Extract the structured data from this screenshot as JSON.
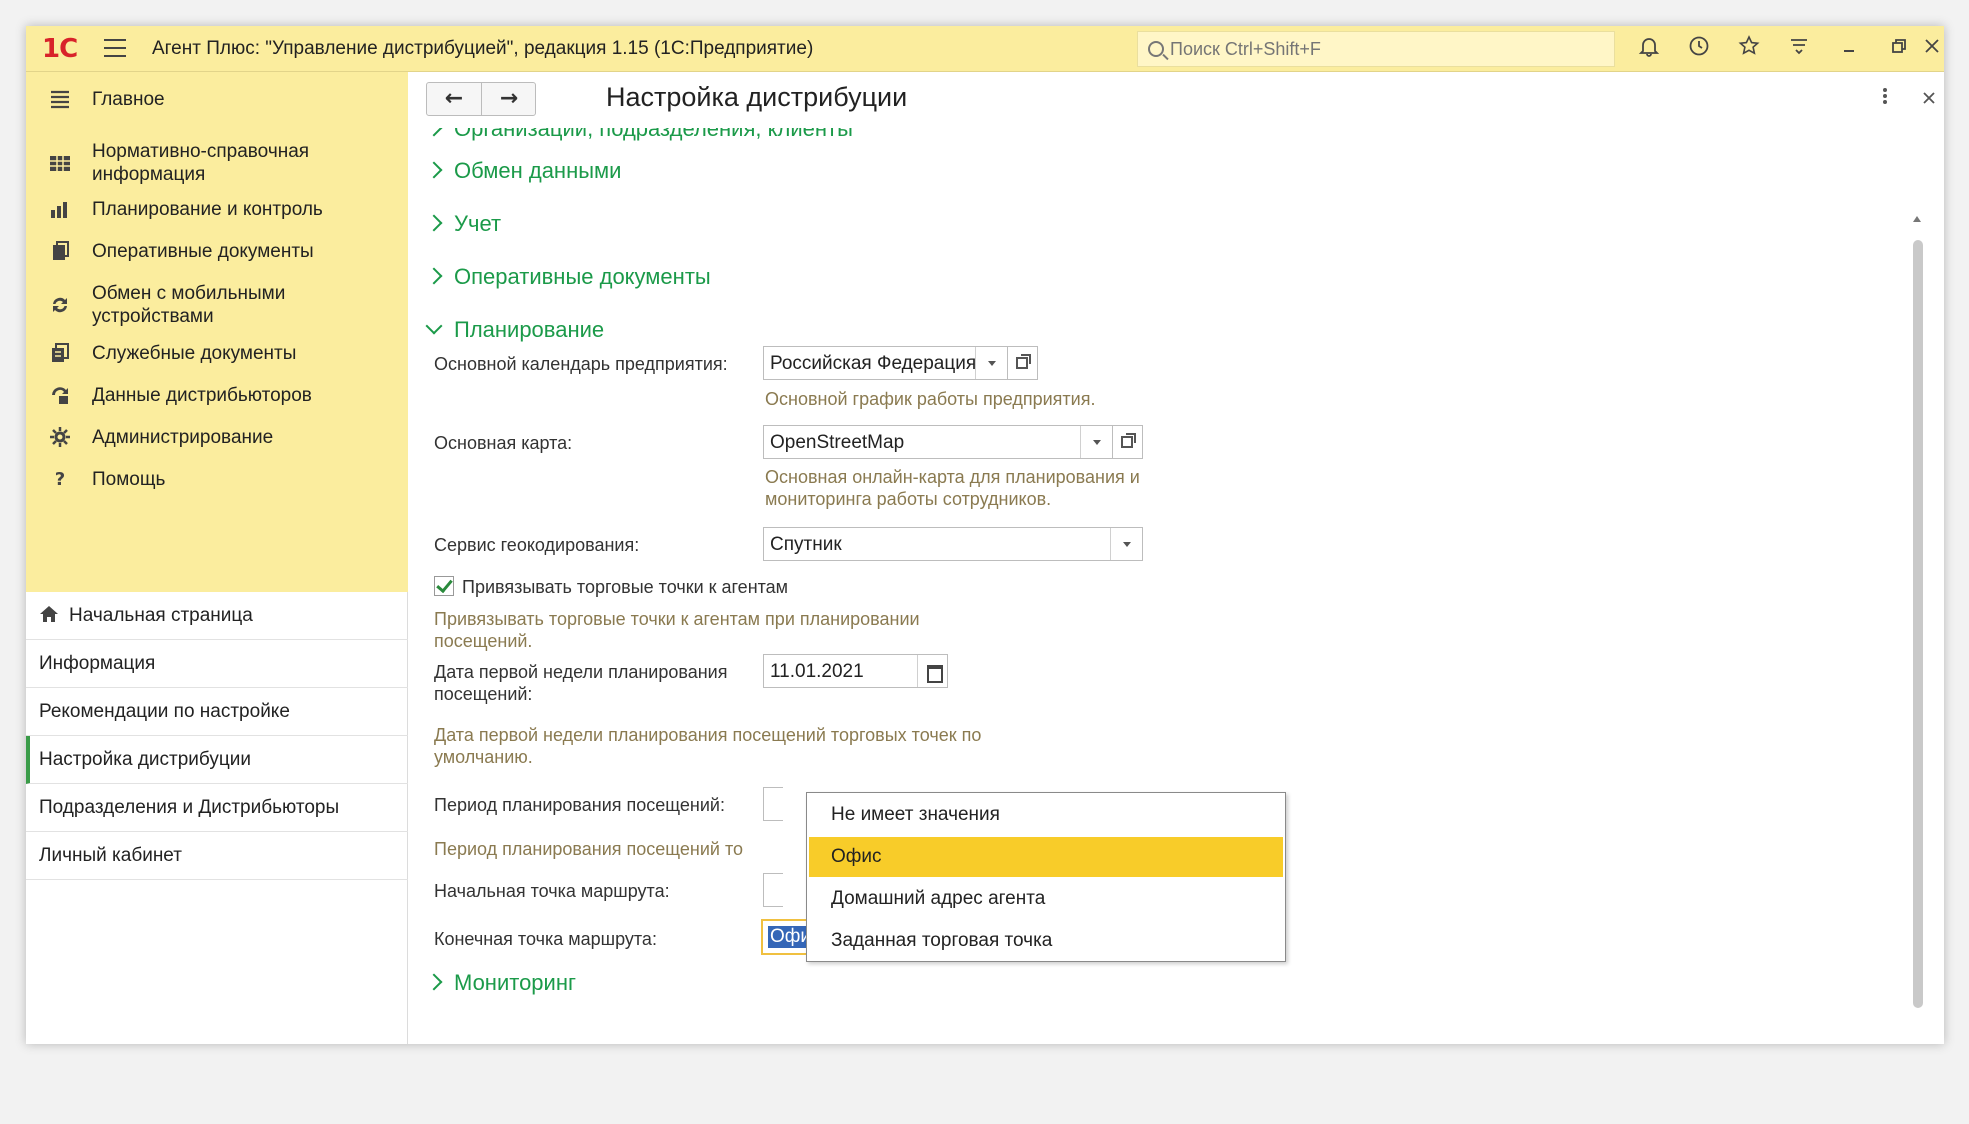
{
  "app": {
    "logo": "1С",
    "title": "Агент Плюс: \"Управление дистрибуцией\", редакция 1.15  (1С:Предприятие)",
    "search_placeholder": "Поиск Ctrl+Shift+F"
  },
  "sidebar": {
    "sections": [
      {
        "label": "Главное",
        "icon": "menu-lines-icon"
      },
      {
        "label": "Нормативно-справочная информация",
        "icon": "table-icon"
      },
      {
        "label": "Планирование и контроль",
        "icon": "bar-chart-icon"
      },
      {
        "label": "Оперативные документы",
        "icon": "documents-icon"
      },
      {
        "label": "Обмен с мобильными устройствами",
        "icon": "sync-icon"
      },
      {
        "label": "Служебные документы",
        "icon": "service-documents-icon"
      },
      {
        "label": "Данные дистрибьюторов",
        "icon": "distributor-data-icon"
      },
      {
        "label": "Администрирование",
        "icon": "gear-icon"
      },
      {
        "label": "Помощь",
        "icon": "question-icon"
      }
    ],
    "nav": [
      {
        "label": "Начальная страница",
        "icon": "home-icon"
      },
      {
        "label": "Информация"
      },
      {
        "label": "Рекомендации по настройке"
      },
      {
        "label": "Настройка дистрибуции"
      },
      {
        "label": "Подразделения и Дистрибьюторы"
      },
      {
        "label": "Личный кабинет"
      }
    ]
  },
  "page": {
    "title": "Настройка дистрибуции",
    "groups": {
      "org": "Организации, подразделения, клиенты",
      "exchange": "Обмен данными",
      "accounting": "Учет",
      "operative": "Оперативные документы",
      "planning": "Планирование",
      "monitoring": "Мониторинг"
    },
    "planning": {
      "calendar_label": "Основной календарь предприятия:",
      "calendar_value": "Российская Федерация",
      "calendar_hint": "Основной график работы предприятия.",
      "map_label": "Основная карта:",
      "map_value": "OpenStreetMap",
      "map_hint": "Основная онлайн-карта для планирования и мониторинга работы сотрудников.",
      "geocoding_label": "Сервис геокодирования:",
      "geocoding_value": "Спутник",
      "bind_label": "Привязывать торговые точки к агентам",
      "bind_checked": true,
      "bind_hint": "Привязывать торговые точки к агентам при планировании посещений.",
      "first_week_label": "Дата первой недели планирования посещений:",
      "first_week_value": "11.01.2021",
      "first_week_hint": "Дата первой недели планирования посещений торговых точек по умолчанию.",
      "period_label": "Период планирования посещений:",
      "period_hint": "Период планирования посещений то",
      "start_point_label": "Начальная точка маршрута:",
      "end_point_label": "Конечная точка маршрута:",
      "end_point_value": "Офис"
    },
    "dropdown": {
      "options": [
        "Не имеет значения",
        "Офис",
        "Домашний адрес агента",
        "Заданная торговая точка"
      ],
      "selected": "Офис"
    }
  },
  "colors": {
    "accent_yellow": "#fbed9e",
    "group_green": "#1b9a49",
    "selection_yellow": "#f8cc29",
    "hint_brown": "#8a7a50"
  }
}
